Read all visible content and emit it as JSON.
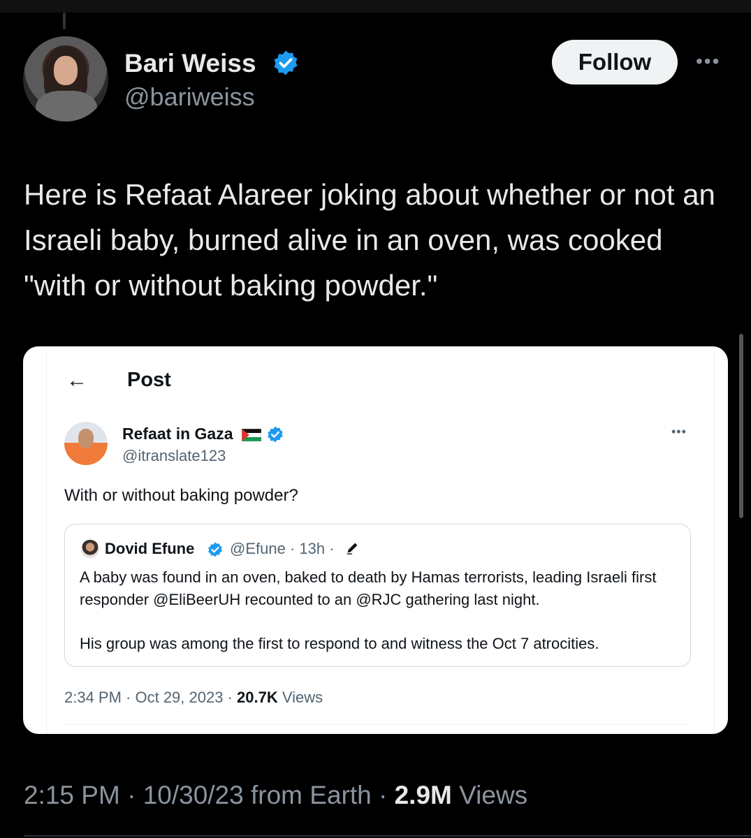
{
  "tweet": {
    "author_name": "Bari Weiss",
    "handle": "@bariweiss",
    "follow_label": "Follow",
    "more_label": "•••",
    "text": "Here is Refaat Alareer joking about whether or not an Israeli baby, burned alive in an oven, was cooked \"with or without baking powder.\"",
    "time": "2:15 PM",
    "sep": "·",
    "date_source": "10/30/23 from Earth",
    "views_count": "2.9M",
    "views_label": "Views"
  },
  "embed": {
    "back_arrow": "←",
    "page_title": "Post",
    "author_name": "Refaat in Gaza",
    "handle": "@itranslate123",
    "more_label": "•••",
    "text": "With or without baking powder?",
    "quote": {
      "author_name": "Dovid Efune",
      "handle_time": "@Efune · 13h ·",
      "paragraph1": "A baby was found in an oven, baked to death by Hamas terrorists, leading Israeli first responder @EliBeerUH recounted to an @RJC gathering last night.",
      "paragraph2": "His group was among the first to respond to and witness the Oct 7 atrocities."
    },
    "time_date": "2:34 PM · Oct 29, 2023 ·",
    "views_count": "20.7K",
    "views_label": "Views"
  },
  "colors": {
    "verified_blue": "#1d9bf0",
    "background": "#000000",
    "muted_text": "#8b949e"
  },
  "icons": {
    "verified": "verified-badge-icon",
    "flag": "palestine-flag-icon",
    "edit": "pencil-icon",
    "back": "back-arrow-icon",
    "more": "more-dots-icon"
  }
}
